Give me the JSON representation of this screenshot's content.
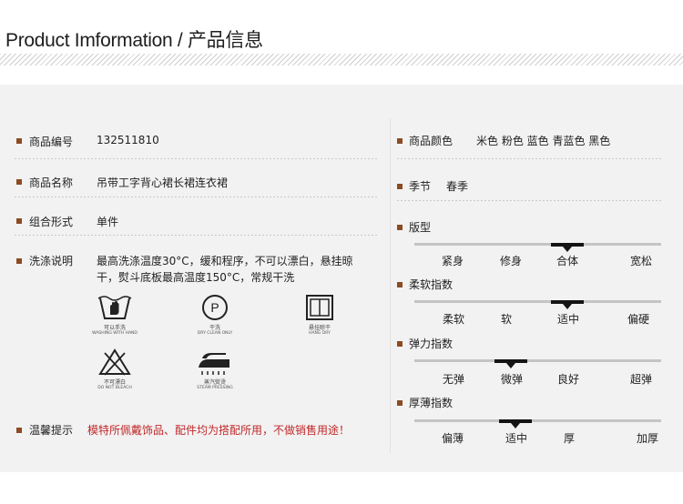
{
  "header": {
    "title": "Product Imformation / 产品信息"
  },
  "colors": {
    "bullet": "#8c4b22",
    "tip_text": "#c0282a",
    "panel_bg": "#f2f2f2",
    "marker": "#141414"
  },
  "left": {
    "rows": [
      {
        "label": "商品编号",
        "value": "132511810"
      },
      {
        "label": "商品名称",
        "value": "吊带工字背心裙长裙连衣裙"
      },
      {
        "label": "组合形式",
        "value": "单件"
      },
      {
        "label": "洗涤说明",
        "value": "最高洗涤温度30°C，缓和程序，不可以漂白，悬挂晾干，熨斗底板最高温度150°C，常规干洗"
      }
    ],
    "care_icons": [
      {
        "icon": "hand-wash-icon",
        "cn": "可以手洗",
        "en": "WASHING WITH HAND"
      },
      {
        "icon": "dry-clean-icon",
        "cn": "干洗",
        "en": "DRY CLEAN ONLY"
      },
      {
        "icon": "hang-dry-icon",
        "cn": "悬挂晾干",
        "en": "HANG DRY"
      },
      {
        "icon": "no-bleach-icon",
        "cn": "不可漂白",
        "en": "DO NOT BLEACH"
      },
      {
        "icon": "steam-iron-icon",
        "cn": "蒸汽熨烫",
        "en": "STEAM PRESSING"
      }
    ],
    "tip": {
      "label": "温馨提示",
      "value": "模特所佩戴饰品、配件均为搭配所用，不做销售用途！"
    }
  },
  "right": {
    "color": {
      "label": "商品颜色",
      "value": "米色 粉色 蓝色 青蓝色 黑色"
    },
    "season": {
      "label": "季节",
      "value": "春季"
    },
    "scales": [
      {
        "label": "版型",
        "options": [
          "紧身",
          "修身",
          "合体",
          "宽松"
        ],
        "selected_position": 0.62
      },
      {
        "label": "柔软指数",
        "options": [
          "柔软",
          "软",
          "适中",
          "偏硬"
        ],
        "selected_position": 0.62
      },
      {
        "label": "弹力指数",
        "options": [
          "无弹",
          "微弹",
          "良好",
          "超弹"
        ],
        "selected_position": 0.39
      },
      {
        "label": "厚薄指数",
        "options": [
          "偏薄",
          "适中",
          "厚",
          "加厚"
        ],
        "selected_position": 0.41
      }
    ]
  }
}
